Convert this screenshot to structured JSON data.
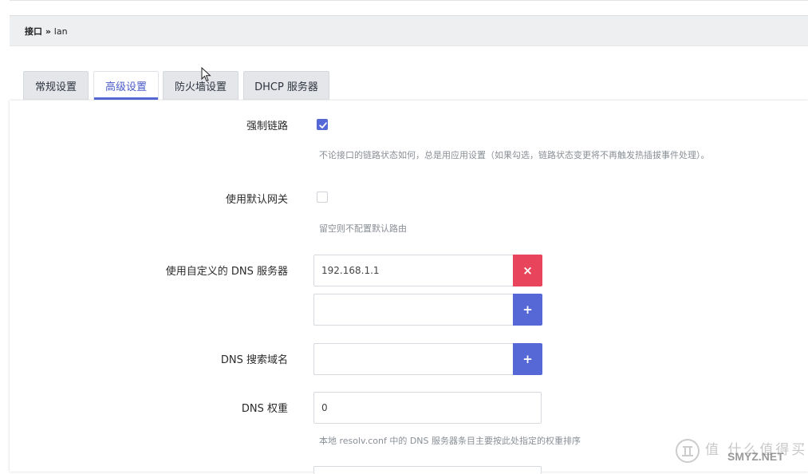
{
  "breadcrumb": {
    "parent": "接口",
    "separator": " » ",
    "current": "lan"
  },
  "tabs": [
    {
      "label": "常规设置",
      "active": false
    },
    {
      "label": "高级设置",
      "active": true
    },
    {
      "label": "防火墙设置",
      "active": false
    },
    {
      "label": "DHCP 服务器",
      "active": false
    }
  ],
  "form": {
    "force_link": {
      "label": "强制链路",
      "checked": true,
      "description": "不论接口的链路状态如何，总是用应用设置（如果勾选，链路状态变更将不再触发热插拔事件处理）。"
    },
    "default_gateway": {
      "label": "使用默认网关",
      "checked": false,
      "description": "留空则不配置默认路由"
    },
    "custom_dns": {
      "label": "使用自定义的 DNS 服务器",
      "values": [
        "192.168.1.1",
        ""
      ],
      "remove_symbol": "×",
      "add_symbol": "+"
    },
    "dns_search": {
      "label": "DNS 搜索域名",
      "value": "",
      "add_symbol": "+"
    },
    "dns_weight": {
      "label": "DNS 权重",
      "value": "0",
      "description": "本地 resolv.conf 中的 DNS 服务器条目主要按此处指定的权重排序"
    }
  },
  "colors": {
    "accent": "#5568d6",
    "danger": "#e8455c",
    "breadcrumb_bg": "#eeeff1",
    "tab_bg": "#e4e6e9"
  },
  "watermark": {
    "top": "值 什么值得买",
    "bottom": "SMYZ.NET"
  }
}
